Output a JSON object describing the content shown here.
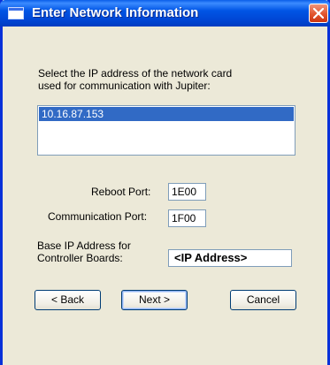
{
  "window": {
    "title": "Enter Network Information",
    "close_icon": "close-x-icon"
  },
  "prompt": {
    "line1": "Select the IP address of the network card",
    "line2": "used for communication with Jupiter:"
  },
  "ip_list": {
    "items": [
      "10.16.87.153"
    ],
    "selected_index": 0
  },
  "fields": {
    "reboot_port": {
      "label": "Reboot Port:",
      "value": "1E00"
    },
    "communication_port": {
      "label": "Communication Port:",
      "value": "1F00"
    },
    "base_ip": {
      "label_line1": "Base IP Address for",
      "label_line2": "Controller Boards:",
      "value": "<IP Address>"
    }
  },
  "buttons": {
    "back": "< Back",
    "next": "Next >",
    "cancel": "Cancel"
  },
  "colors": {
    "titlebar": "#0055e5",
    "selection": "#316ac5",
    "dialog_bg": "#ece9d8"
  }
}
